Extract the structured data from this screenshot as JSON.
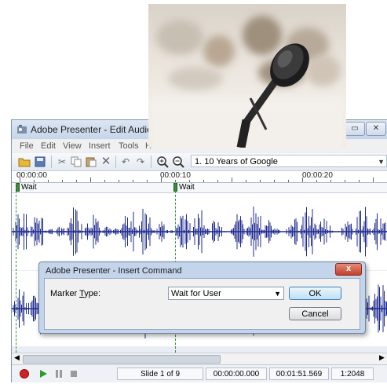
{
  "window": {
    "title": "Adobe Presenter - Edit Audio",
    "buttons": {
      "restore": "▭",
      "close": "✕"
    }
  },
  "menu": [
    "File",
    "Edit",
    "View",
    "Insert",
    "Tools",
    "H"
  ],
  "toolbar": {
    "icons": [
      "open-folder-icon",
      "save-icon",
      "cut-icon",
      "copy-icon",
      "paste-icon",
      "delete-icon",
      "undo-icon",
      "redo-icon",
      "zoom-in-icon",
      "zoom-out-icon"
    ],
    "slide_selector": "1. 10 Years of Google"
  },
  "ruler": {
    "labels": [
      "00:00:00",
      "00:00:10",
      "00:00:20"
    ]
  },
  "markers": [
    {
      "label": "Wait"
    },
    {
      "label": "Wait"
    }
  ],
  "statusbar": {
    "slide": "Slide 1 of 9",
    "position": "00:00:00.000",
    "duration": "00:01:51.569",
    "zoom": "1:2048"
  },
  "dialog": {
    "title": "Adobe Presenter - Insert Command",
    "close": "x",
    "marker_type_label": "Marker Type:",
    "marker_type_value": "Wait for User",
    "ok_label": "OK",
    "cancel_label": "Cancel"
  },
  "colors": {
    "waveform": "#1f2b8f",
    "playhead": "#3e8e3e",
    "record": "#d42020",
    "play": "#2f9a2f"
  }
}
